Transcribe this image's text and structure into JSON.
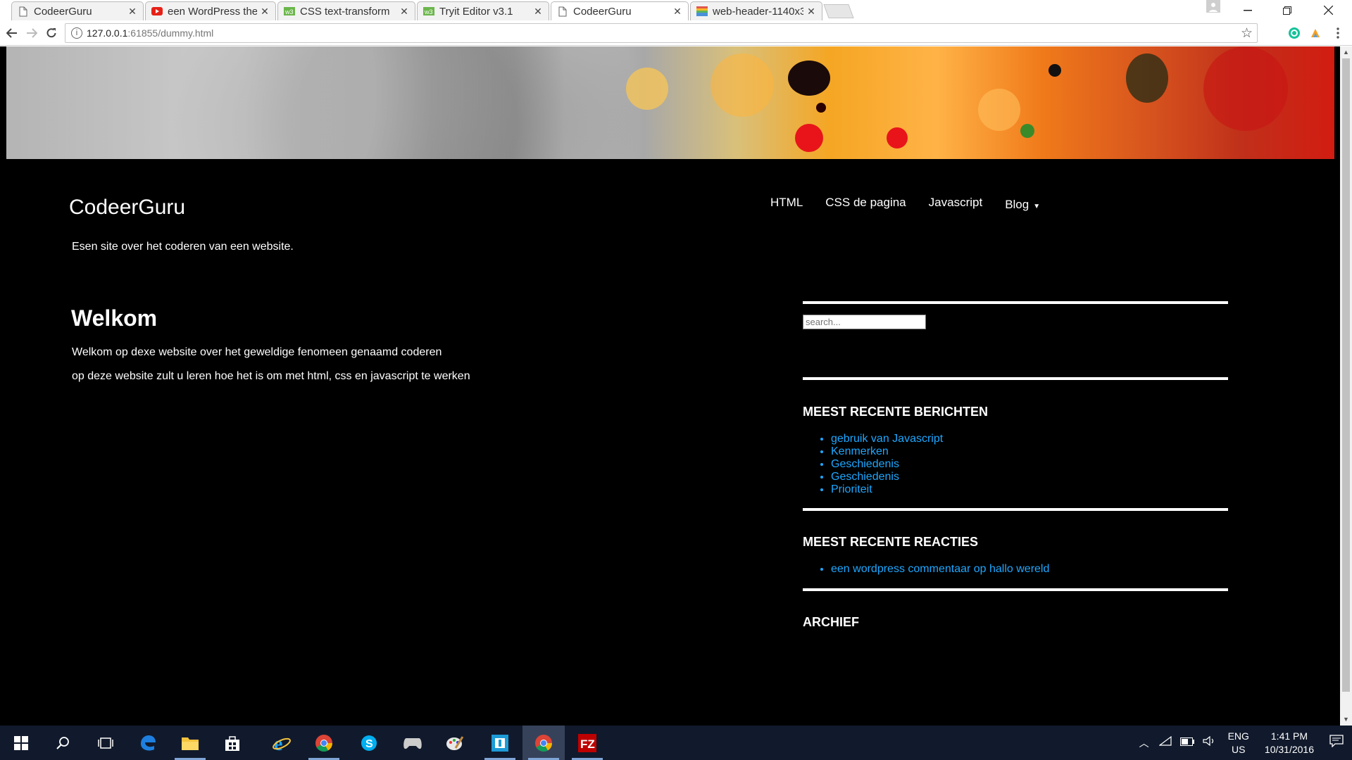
{
  "tabs": [
    {
      "title": "CodeerGuru",
      "favicon": "page-icon"
    },
    {
      "title": "een WordPress ther",
      "favicon": "youtube-icon"
    },
    {
      "title": "CSS text-transform",
      "favicon": "w3schools-icon"
    },
    {
      "title": "Tryit Editor v3.1",
      "favicon": "w3schools-icon"
    },
    {
      "title": "CodeerGuru",
      "favicon": "page-icon",
      "active": true
    },
    {
      "title": "web-header-1140x3",
      "favicon": "image-icon"
    }
  ],
  "address_bar": {
    "host": "127.0.0.1",
    "rest": ":61855/dummy.html"
  },
  "site": {
    "title": "CodeerGuru",
    "tagline": "Esen site over het coderen van een website.",
    "nav": [
      "HTML",
      "CSS de pagina",
      "Javascript",
      "Blog"
    ]
  },
  "content": {
    "heading": "Welkom",
    "paragraphs": [
      "Welkom op dexe website over het geweldige fenomeen genaamd coderen",
      "op deze website zult u leren hoe het is om met html, css en javascript te werken"
    ]
  },
  "sidebar": {
    "search_placeholder": "search...",
    "recent_posts_title": "MEEST RECENTE BERICHTEN",
    "recent_posts": [
      "gebruik van Javascript",
      "Kenmerken",
      "Geschiedenis",
      "Geschiedenis",
      "Prioriteit"
    ],
    "recent_comments_title": "MEEST RECENTE REACTIES",
    "recent_comments": [
      "een wordpress commentaar op hallo wereld"
    ],
    "archive_title": "ARCHIEF"
  },
  "colors": {
    "link": "#1ea7ff",
    "page_bg": "#000000",
    "taskbar": "#111a2c"
  },
  "tray": {
    "lang1": "ENG",
    "lang2": "US",
    "time": "1:41 PM",
    "date": "10/31/2016"
  }
}
